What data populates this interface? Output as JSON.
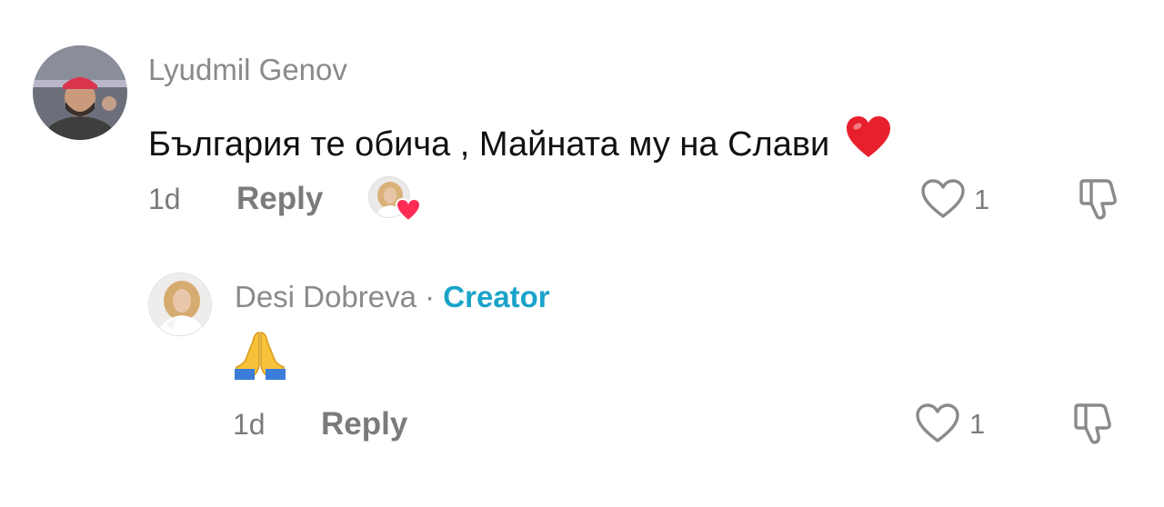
{
  "comments": [
    {
      "username": "Lyudmil Genov",
      "text": "България те обича , Майната му на Слави",
      "time": "1d",
      "reply_label": "Reply",
      "likes": "1",
      "creator_liked": true
    },
    {
      "username": "Desi Dobreva",
      "separator": "·",
      "badge": "Creator",
      "text": "🙏",
      "time": "1d",
      "reply_label": "Reply",
      "likes": "1"
    }
  ],
  "colors": {
    "creator_badge": "#1aa3c9",
    "heart_badge": "#fe2c55",
    "muted_text": "#7b7b7b"
  }
}
